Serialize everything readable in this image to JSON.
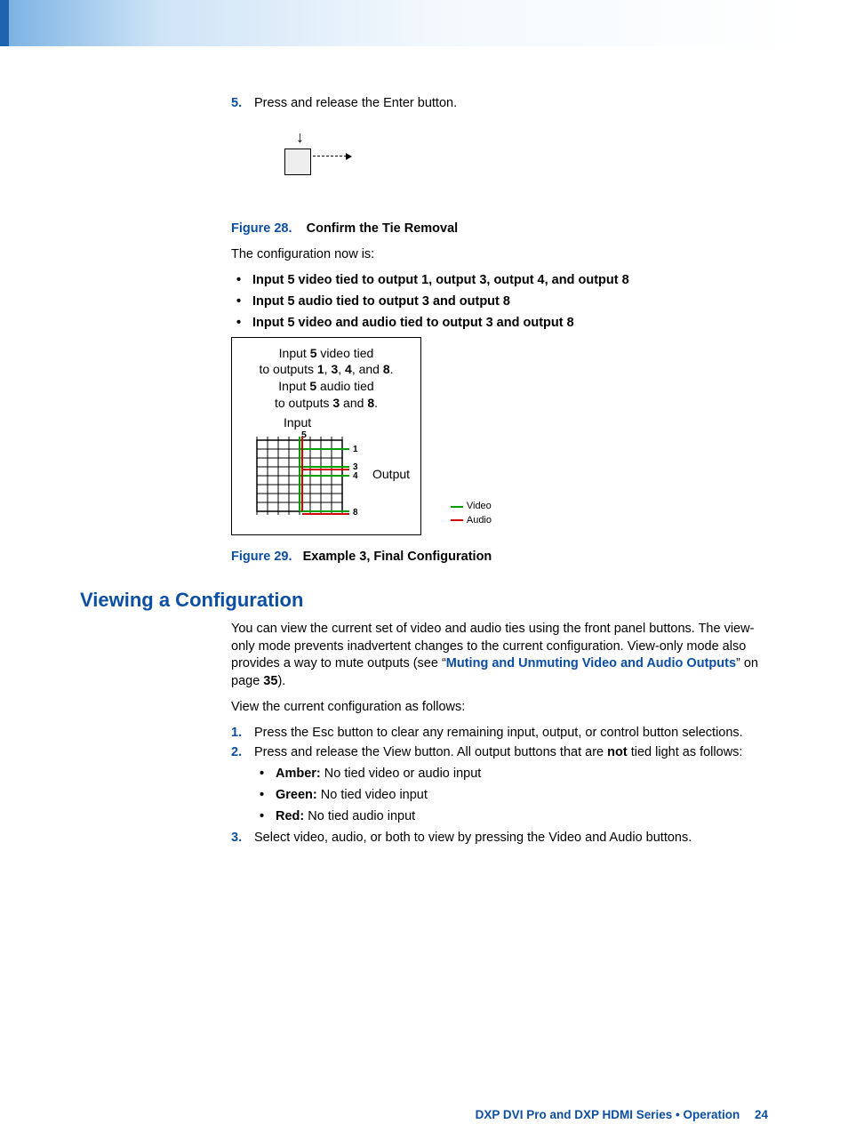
{
  "step5": {
    "marker": "5.",
    "text": "Press and release the Enter button."
  },
  "fig28": {
    "num": "Figure 28.",
    "title": "Confirm the Tie Removal"
  },
  "nowis": "The configuration now is:",
  "tiebullets": [
    "Input 5 video tied to output 1, output 3, output 4, and output 8",
    "Input 5 audio tied to output 3 and output 8",
    "Input 5 video and audio tied to output 3 and output 8"
  ],
  "cfgdiag": {
    "line1a": "Input ",
    "line1b": "5",
    "line1c": " video tied",
    "line2a": "to outputs ",
    "line2b": "1",
    "line2c": ", ",
    "line2d": "3",
    "line2e": ", ",
    "line2f": "4",
    "line2g": ", and ",
    "line2h": "8",
    "line2i": ".",
    "line3a": "Input ",
    "line3b": "5",
    "line3c": " audio tied",
    "line4a": "to outputs ",
    "line4b": "3",
    "line4c": " and ",
    "line4d": "8",
    "line4e": ".",
    "inputlabel": "Input",
    "outputlabel": "Output",
    "col5": "5",
    "out1": "1",
    "out3": "3",
    "out4": "4",
    "out8": "8",
    "legend_video": "Video",
    "legend_audio": "Audio"
  },
  "fig29": {
    "num": "Figure 29.",
    "title": "Example 3, Final Configuration"
  },
  "h2": "Viewing a Configuration",
  "para1a": "You can view the current set of video and audio ties using the front panel buttons. The view-only mode prevents inadvertent changes to the current configuration. View-only mode also provides a way to mute outputs (see “",
  "para1_link": "Muting and Unmuting Video and Audio Outputs",
  "para1b": "” on page ",
  "para1_page": "35",
  "para1c": ").",
  "para2": "View the current configuration as follows:",
  "steps": [
    {
      "marker": "1.",
      "text": "Press the Esc button to clear any remaining input, output, or control button selections."
    },
    {
      "marker": "2.",
      "texta": "Press and release the View button. All output buttons that are ",
      "bold": "not",
      "textb": " tied light as follows:"
    },
    {
      "marker": "3.",
      "text": "Select video, audio, or both to view by pressing the Video and Audio buttons."
    }
  ],
  "colorlist": [
    {
      "label": "Amber:",
      "text": " No tied video or audio input"
    },
    {
      "label": "Green:",
      "text": " No tied video input"
    },
    {
      "label": "Red:",
      "text": " No tied audio input"
    }
  ],
  "footer": {
    "title": "DXP DVI Pro and DXP HDMI Series • Operation",
    "page": "24"
  }
}
